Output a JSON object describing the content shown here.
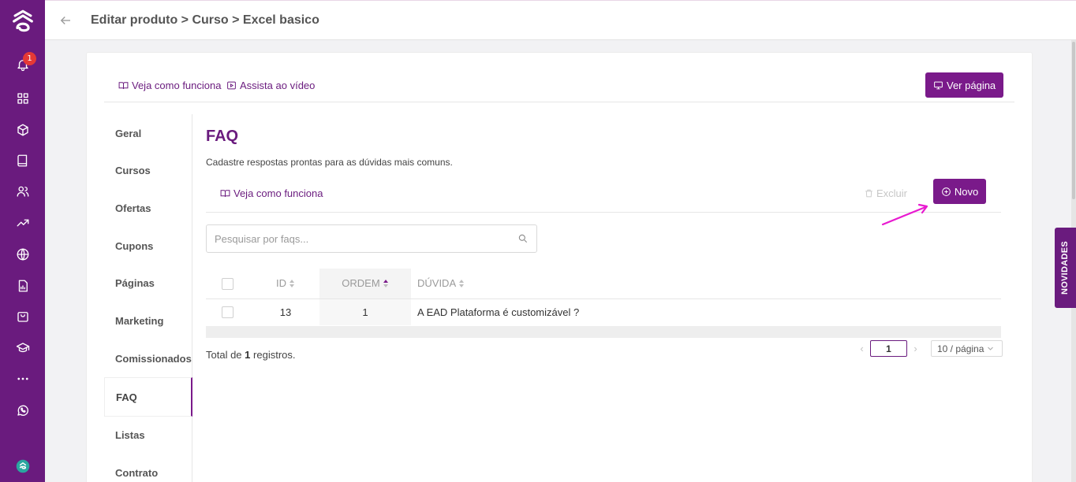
{
  "rail": {
    "notification_count": "1",
    "icons": [
      "bell-icon",
      "grid-icon",
      "box-icon",
      "book-icon",
      "users-icon",
      "trending-icon",
      "globe-icon",
      "report-icon",
      "bag-icon",
      "graduation-icon",
      "more-icon",
      "whatsapp-icon"
    ]
  },
  "header": {
    "breadcrumb": "Editar produto > Curso > Excel basico"
  },
  "card": {
    "link_how_it_works": "Veja como funciona",
    "link_watch_video": "Assista ao vídeo",
    "view_page_label": "Ver página"
  },
  "submenu": {
    "items": [
      {
        "label": "Geral"
      },
      {
        "label": "Cursos"
      },
      {
        "label": "Ofertas"
      },
      {
        "label": "Cupons"
      },
      {
        "label": "Páginas"
      },
      {
        "label": "Marketing"
      },
      {
        "label": "Comissionados"
      },
      {
        "label": "FAQ"
      },
      {
        "label": "Listas"
      },
      {
        "label": "Contrato"
      }
    ],
    "active": "FAQ"
  },
  "faq": {
    "title": "FAQ",
    "subtitle": "Cadastre respostas prontas para as dúvidas mais comuns.",
    "how_it_works": "Veja como funciona",
    "delete_label": "Excluir",
    "new_label": "Novo",
    "search_placeholder": "Pesquisar por faqs...",
    "columns": [
      "ID",
      "ORDEM",
      "DÚVIDA"
    ],
    "rows": [
      {
        "id": "13",
        "ordem": "1",
        "duvida": "A EAD Plataforma é customizável ?"
      }
    ],
    "total_prefix": "Total de",
    "total_count": "1",
    "total_suffix": "registros.",
    "current_page": "1",
    "page_size": "10 / página"
  },
  "novidades_label": "NOVIDADES",
  "colors": {
    "brand": "#6a1b7e",
    "button": "#7a1a8a",
    "annotation_arrow": "#e81ad0"
  }
}
